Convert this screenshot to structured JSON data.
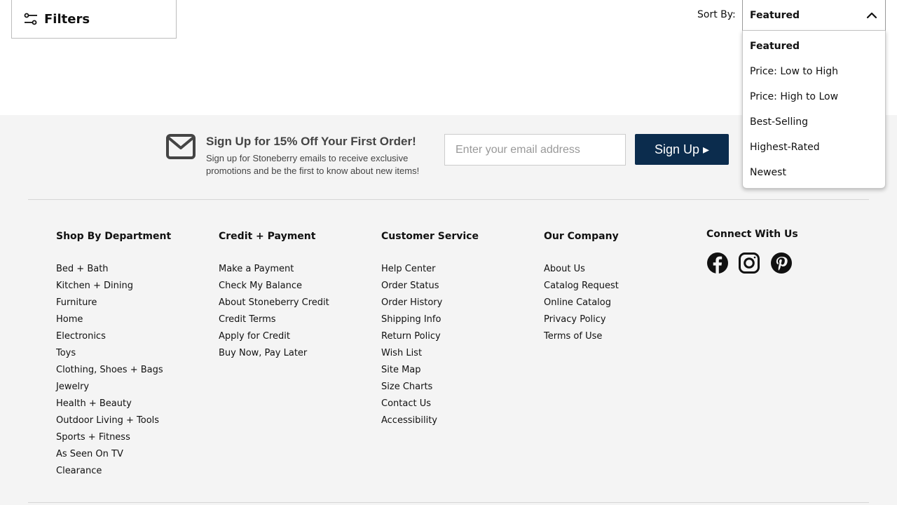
{
  "toolbar": {
    "filters_label": "Filters",
    "sort_label": "Sort By:",
    "sort_selected": "Featured",
    "sort_options": [
      "Featured",
      "Price: Low to High",
      "Price: High to Low",
      "Best-Selling",
      "Highest-Rated",
      "Newest"
    ]
  },
  "signup": {
    "title": "Sign Up for 15% Off Your First Order!",
    "description": "Sign up for Stoneberry emails to receive exclusive promotions and be the first to know about new items!",
    "email_placeholder": "Enter your email address",
    "button_label": "Sign Up ▸"
  },
  "footer": {
    "columns": [
      {
        "heading": "Shop By Department",
        "links": [
          "Bed + Bath",
          "Kitchen + Dining",
          "Furniture",
          "Home",
          "Electronics",
          "Toys",
          "Clothing, Shoes + Bags",
          "Jewelry",
          "Health + Beauty",
          "Outdoor Living + Tools",
          "Sports + Fitness",
          "As Seen On TV",
          "Clearance"
        ]
      },
      {
        "heading": "Credit + Payment",
        "links": [
          "Make a Payment",
          "Check My Balance",
          "About Stoneberry Credit",
          "Credit Terms",
          "Apply for Credit",
          "Buy Now, Pay Later"
        ]
      },
      {
        "heading": "Customer Service",
        "links": [
          "Help Center",
          "Order Status",
          "Order History",
          "Shipping Info",
          "Return Policy",
          "Wish List",
          "Site Map",
          "Size Charts",
          "Contact Us",
          "Accessibility"
        ]
      },
      {
        "heading": "Our Company",
        "links": [
          "About Us",
          "Catalog Request",
          "Online Catalog",
          "Privacy Policy",
          "Terms of Use"
        ]
      }
    ],
    "connect_heading": "Connect With Us",
    "social_icons": [
      "facebook-icon",
      "instagram-icon",
      "pinterest-icon"
    ]
  },
  "colors": {
    "signup_button": "#0b2c4d",
    "footer_background": "#f4f4f4"
  }
}
